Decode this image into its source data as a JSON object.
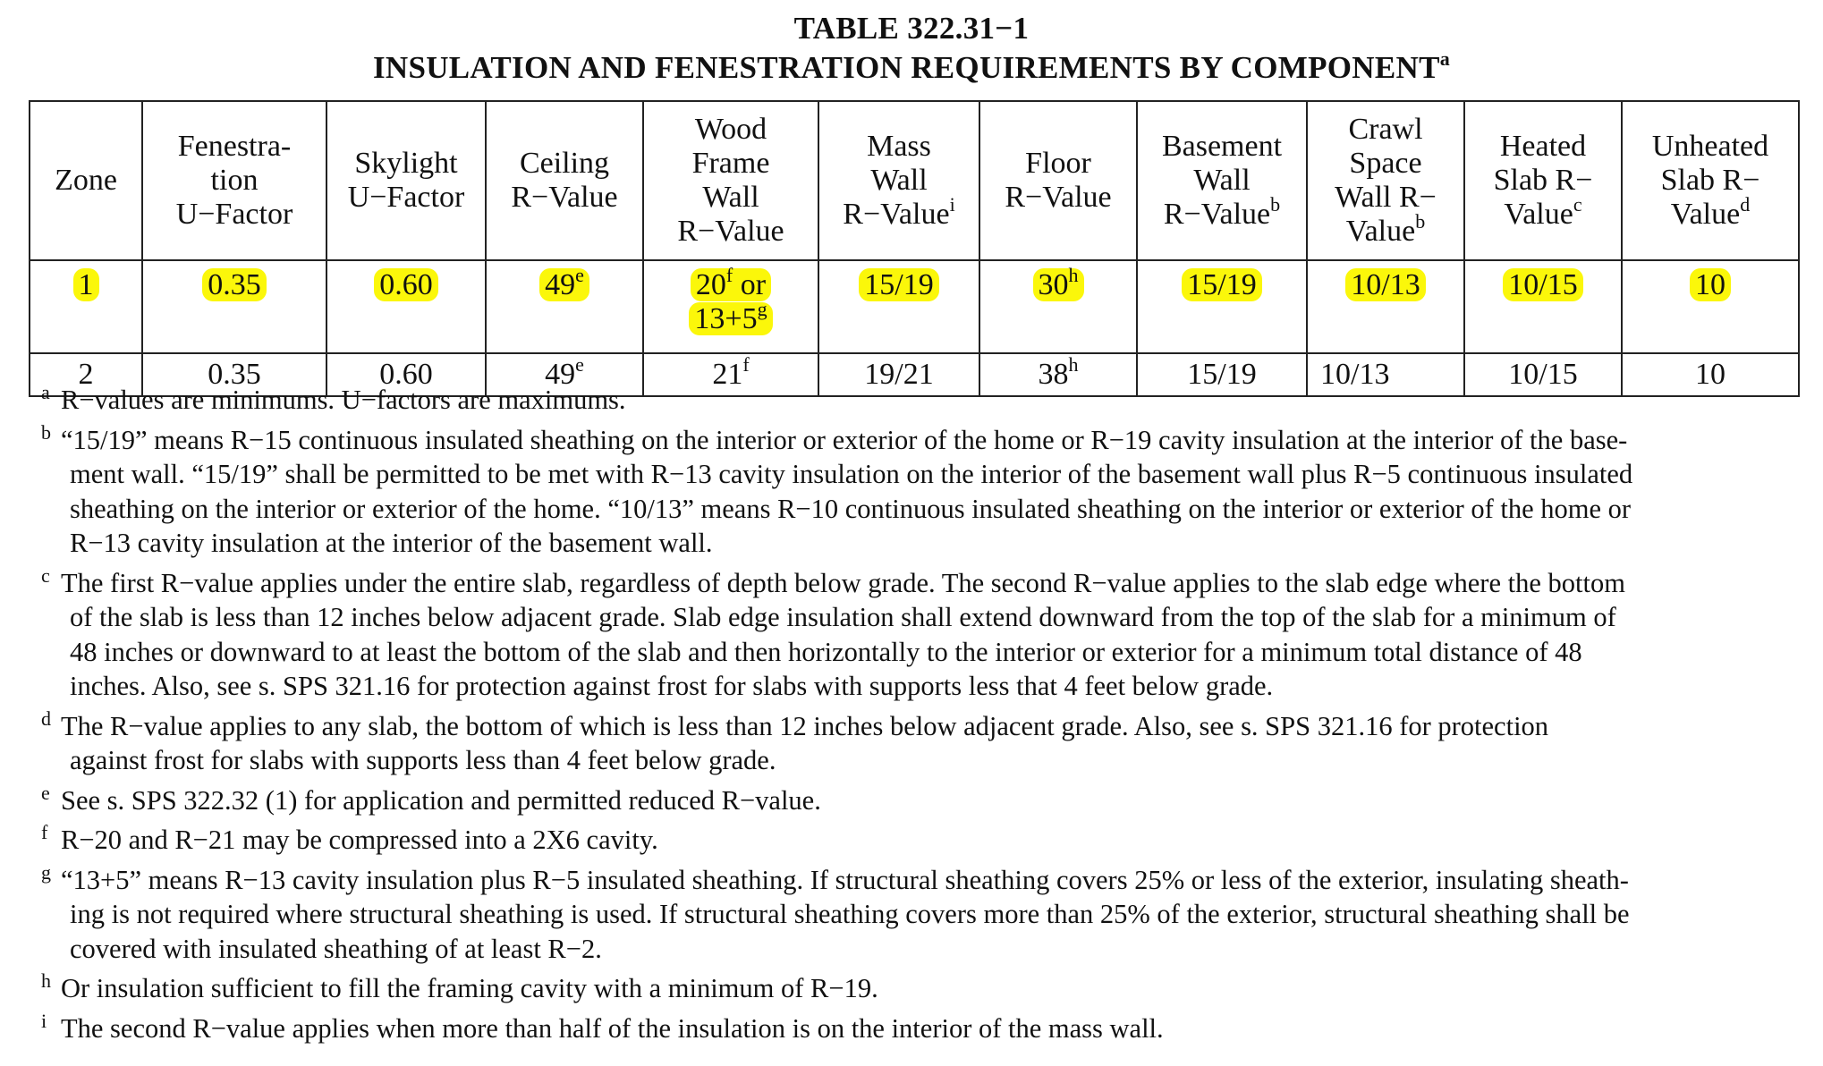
{
  "title": {
    "line1": "TABLE 322.31−1",
    "line2": "INSULATION AND FENESTRATION REQUIREMENTS BY COMPONENT",
    "line2_mark": "a"
  },
  "table": {
    "headers": [
      {
        "lines": [
          "Zone"
        ],
        "mark": ""
      },
      {
        "lines": [
          "Fenestra-",
          "tion",
          "U−Factor"
        ],
        "mark": ""
      },
      {
        "lines": [
          "Skylight",
          "U−Factor"
        ],
        "mark": ""
      },
      {
        "lines": [
          "Ceiling",
          "R−Value"
        ],
        "mark": ""
      },
      {
        "lines": [
          "Wood",
          "Frame",
          "Wall",
          "R−Value"
        ],
        "mark": ""
      },
      {
        "lines": [
          "Mass",
          "Wall",
          "R−Value"
        ],
        "mark": "i"
      },
      {
        "lines": [
          "Floor",
          "R−Value"
        ],
        "mark": ""
      },
      {
        "lines": [
          "Basement",
          "Wall",
          "R−Value"
        ],
        "mark": "b"
      },
      {
        "lines": [
          "Crawl",
          "Space",
          "Wall R−",
          "Value"
        ],
        "mark": "b"
      },
      {
        "lines": [
          "Heated",
          "Slab R−",
          "Value"
        ],
        "mark": "c"
      },
      {
        "lines": [
          "Unheated",
          "Slab R−",
          "Value"
        ],
        "mark": "d"
      }
    ],
    "rows": [
      {
        "highlighted": true,
        "cells": [
          {
            "text": "1",
            "mark": ""
          },
          {
            "text": "0.35",
            "mark": ""
          },
          {
            "text": "0.60",
            "mark": ""
          },
          {
            "text": "49",
            "mark": "e"
          },
          {
            "text": "20",
            "mark": "f",
            "text2": " or",
            "line2": "13+5",
            "mark2": "g"
          },
          {
            "text": "15/19",
            "mark": ""
          },
          {
            "text": "30",
            "mark": "h"
          },
          {
            "text": "15/19",
            "mark": ""
          },
          {
            "text": "10/13",
            "mark": ""
          },
          {
            "text": "10/15",
            "mark": ""
          },
          {
            "text": "10",
            "mark": ""
          }
        ]
      },
      {
        "highlighted": false,
        "cells": [
          {
            "text": "2",
            "mark": ""
          },
          {
            "text": "0.35",
            "mark": ""
          },
          {
            "text": "0.60",
            "mark": ""
          },
          {
            "text": "49",
            "mark": "e"
          },
          {
            "text": "21",
            "mark": "f"
          },
          {
            "text": "19/21",
            "mark": ""
          },
          {
            "text": "38",
            "mark": "h"
          },
          {
            "text": "15/19",
            "mark": ""
          },
          {
            "text": "10/13",
            "mark": ""
          },
          {
            "text": "10/15",
            "mark": ""
          },
          {
            "text": "10",
            "mark": ""
          }
        ]
      }
    ]
  },
  "notes": [
    {
      "mark": "a",
      "lines": [
        "R−values are minimums.  U−factors are maximums."
      ]
    },
    {
      "mark": "b",
      "lines": [
        "“15/19” means R−15 continuous insulated sheathing on the interior or exterior of the home or R−19 cavity insulation at the interior of the base-",
        "ment wall.  “15/19” shall be permitted to be met with R−13 cavity insulation on the interior of the basement wall plus R−5 continuous insulated",
        "sheathing on the interior or exterior of the home.  “10/13” means R−10 continuous insulated sheathing on the interior or exterior of the home or",
        "R−13 cavity insulation at the interior of the basement wall."
      ]
    },
    {
      "mark": "c",
      "lines": [
        "The first R−value applies under the entire slab, regardless of depth below grade.  The second R−value applies to the slab edge where the bottom",
        "of the slab is less than 12 inches below adjacent grade.  Slab edge insulation shall extend downward from the top of the slab for a minimum of",
        "48 inches or downward to at least the bottom of the slab and then horizontally to the interior or exterior for a minimum total distance of 48",
        "inches.  Also, see s. SPS 321.16 for protection against frost for slabs with supports less that 4 feet below grade."
      ]
    },
    {
      "mark": "d",
      "lines": [
        "The R−value applies to any slab, the bottom of which is less than 12 inches below adjacent grade.  Also, see s. SPS 321.16 for protection",
        "against frost for slabs with supports less than 4 feet below grade."
      ]
    },
    {
      "mark": "e",
      "lines": [
        "See s. SPS 322.32 (1) for application and permitted reduced R−value."
      ]
    },
    {
      "mark": "f",
      "lines": [
        "R−20 and R−21 may be compressed into a 2X6 cavity."
      ]
    },
    {
      "mark": "g",
      "lines": [
        "“13+5” means R−13 cavity insulation plus R−5 insulated sheathing.  If structural sheathing covers 25% or less of the exterior, insulating sheath-",
        "ing is not required where structural sheathing is used.  If structural sheathing covers more than 25% of the exterior, structural sheathing shall be",
        "covered with insulated sheathing of at least R−2."
      ]
    },
    {
      "mark": "h",
      "lines": [
        "Or insulation sufficient to fill the framing cavity with a minimum of R−19."
      ]
    },
    {
      "mark": "i",
      "lines": [
        "The second R−value applies when more than half of the insulation is on the interior of the mass wall."
      ]
    }
  ],
  "colors": {
    "highlight": "#fbf70a",
    "text": "#111111",
    "rule": "#222222"
  }
}
